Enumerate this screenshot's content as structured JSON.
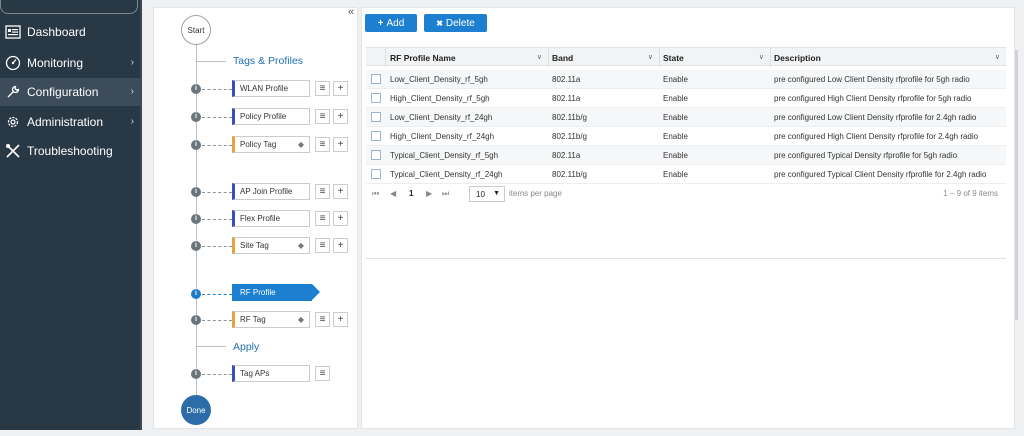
{
  "sidebar": {
    "items": [
      {
        "label": "Dashboard",
        "icon": "dashboard-icon",
        "chevron": false
      },
      {
        "label": "Monitoring",
        "icon": "monitoring-icon",
        "chevron": true
      },
      {
        "label": "Configuration",
        "icon": "wrench-icon",
        "chevron": true,
        "active": true
      },
      {
        "label": "Administration",
        "icon": "gear-icon",
        "chevron": true
      },
      {
        "label": "Troubleshooting",
        "icon": "tools-icon",
        "chevron": false
      }
    ]
  },
  "workflow": {
    "collapse_glyph": "«",
    "start_label": "Start",
    "done_label": "Done",
    "section_tags": "Tags & Profiles",
    "section_apply": "Apply",
    "steps": {
      "wlan_profile": "WLAN Profile",
      "policy_profile": "Policy Profile",
      "policy_tag": "Policy Tag",
      "ap_join_profile": "AP Join Profile",
      "flex_profile": "Flex Profile",
      "site_tag": "Site Tag",
      "rf_profile": "RF Profile",
      "rf_tag": "RF Tag",
      "tag_aps": "Tag APs"
    },
    "info_glyph": "i"
  },
  "toolbar": {
    "add_label": "Add",
    "add_icon": "+",
    "delete_label": "Delete",
    "delete_icon": "✖"
  },
  "table": {
    "columns": [
      "RF Profile Name",
      "Band",
      "State",
      "Description"
    ],
    "rows": [
      {
        "name": "Low_Client_Density_rf_5gh",
        "band": "802.11a",
        "state": "Enable",
        "description": "pre configured Low Client Density rfprofile for 5gh radio"
      },
      {
        "name": "High_Client_Density_rf_5gh",
        "band": "802.11a",
        "state": "Enable",
        "description": "pre configured High Client Density rfprofile for 5gh radio"
      },
      {
        "name": "Low_Client_Density_rf_24gh",
        "band": "802.11b/g",
        "state": "Enable",
        "description": "pre configured Low Client Density rfprofile for 2.4gh radio"
      },
      {
        "name": "High_Client_Density_rf_24gh",
        "band": "802.11b/g",
        "state": "Enable",
        "description": "pre configured High Client Density rfprofile for 2.4gh radio"
      },
      {
        "name": "Typical_Client_Density_rf_5gh",
        "band": "802.11a",
        "state": "Enable",
        "description": "pre configured Typical Density rfprofile for 5gh radio"
      },
      {
        "name": "Typical_Client_Density_rf_24gh",
        "band": "802.11b/g",
        "state": "Enable",
        "description": "pre configured Typical Client Density rfprofile for 2.4gh radio"
      }
    ]
  },
  "pager": {
    "first": "⏮",
    "prev": "◀",
    "page": "1",
    "next": "▶",
    "last": "⏭",
    "per_page": "10",
    "per_page_label": "items per page",
    "summary": "1 – 9 of 9 items"
  },
  "colors": {
    "sidebar_bg": "#283845",
    "accent": "#1d7fcf",
    "link": "#1f6fb2"
  }
}
